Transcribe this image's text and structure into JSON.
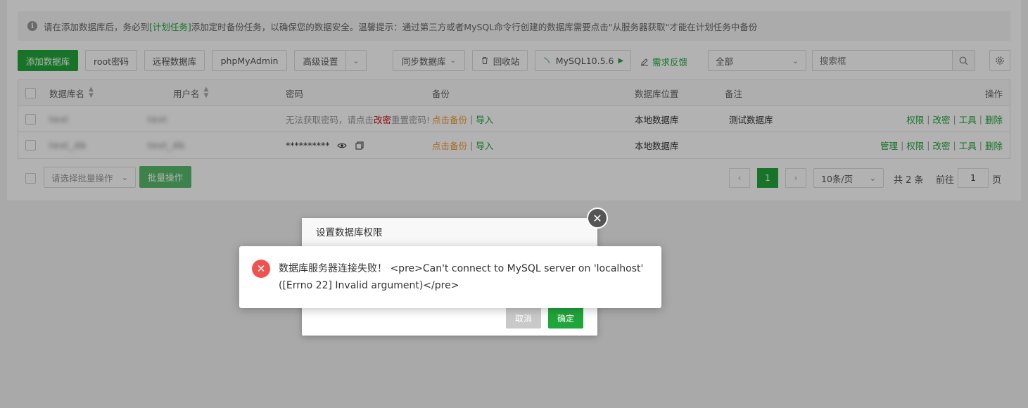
{
  "notice": {
    "prefix": "请在添加数据库后，务必到",
    "link": "[计划任务]",
    "suffix": "添加定时备份任务，以确保您的数据安全。温馨提示：通过第三方或者MySQL命令行创建的数据库需要点击\"从服务器获取\"才能在计划任务中备份"
  },
  "toolbar": {
    "add_db": "添加数据库",
    "root_pwd": "root密码",
    "remote_db": "远程数据库",
    "phpmyadmin": "phpMyAdmin",
    "advanced": "高级设置",
    "sync_db": "同步数据库",
    "recycle": "回收站",
    "mysql_version": "MySQL10.5.6",
    "feedback": "需求反馈",
    "filter_value": "全部",
    "search_placeholder": "搜索框"
  },
  "table": {
    "headers": {
      "db_name": "数据库名",
      "username": "用户名",
      "password": "密码",
      "backup": "备份",
      "location": "数据库位置",
      "remark": "备注",
      "actions": "操作"
    },
    "rows": [
      {
        "db_name": "test",
        "username": "test",
        "pwd_prefix": "无法获取密码，请点击",
        "pwd_link": "改密",
        "pwd_suffix": "重置密码!",
        "backup": "点击备份",
        "import": "导入",
        "location": "本地数据库",
        "remark": "测试数据库",
        "actions": [
          "权限",
          "改密",
          "工具",
          "删除"
        ]
      },
      {
        "db_name": "test_db",
        "username": "test_db",
        "password": "**********",
        "backup": "点击备份",
        "import": "导入",
        "location": "本地数据库",
        "remark": "",
        "actions": [
          "管理",
          "权限",
          "改密",
          "工具",
          "删除"
        ]
      }
    ]
  },
  "batch": {
    "placeholder": "请选择批量操作",
    "button": "批量操作"
  },
  "pagination": {
    "current_page": "1",
    "page_size": "10条/页",
    "total": "共 2 条",
    "goto_label": "前往",
    "goto_value": "1",
    "page_unit": "页"
  },
  "dialog": {
    "title": "设置数据库权限",
    "cancel": "取消",
    "confirm": "确定"
  },
  "toast": {
    "message": "数据库服务器连接失败！ <pre>Can't connect to MySQL server on 'localhost' ([Errno 22] Invalid argument)</pre>"
  },
  "colors": {
    "brand_green": "#20a53a",
    "error_red": "#ef5350",
    "warning_orange": "#f09a37"
  }
}
